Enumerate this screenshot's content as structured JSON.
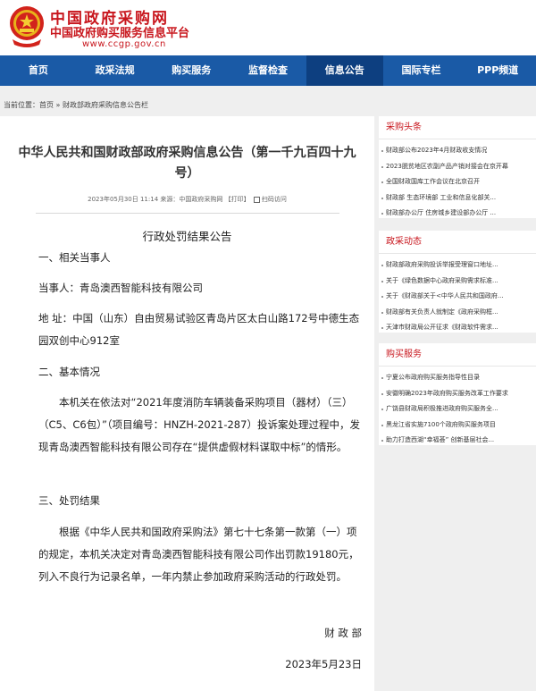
{
  "header": {
    "logo_main": "中国政府采购网",
    "logo_sub": "中国政府购买服务信息平台",
    "logo_url": "www.ccgp.gov.cn"
  },
  "nav": [
    {
      "label": "首页"
    },
    {
      "label": "政采法规"
    },
    {
      "label": "购买服务"
    },
    {
      "label": "监督检查"
    },
    {
      "label": "信息公告",
      "active": true
    },
    {
      "label": "国际专栏"
    },
    {
      "label": "PPP频道"
    }
  ],
  "breadcrumb": {
    "prefix": "当前位置：",
    "home": "首页",
    "sep": " » ",
    "current": "财政部政府采购信息公告栏"
  },
  "article": {
    "title": "中华人民共和国财政部政府采购信息公告（第一千九百四十九号）",
    "meta_date": "2023年05月30日 11:14",
    "meta_source": "来源：中国政府采购网",
    "print_label": "【打印】",
    "qr_label": "扫码访问",
    "heading": "行政处罚结果公告",
    "section1": "一、相关当事人",
    "party": "当事人：青岛澳西智能科技有限公司",
    "address": "地 址：中国（山东）自由贸易试验区青岛片区太白山路172号中德生态园双创中心912室",
    "section2": "二、基本情况",
    "basic": "本机关在依法对“2021年度消防车辆装备采购项目（器材）（三）（C5、C6包）”（项目编号：HNZH-2021-287）投诉案处理过程中，发现青岛澳西智能科技有限公司存在“提供虚假材料谋取中标”的情形。",
    "section3": "三、处罚结果",
    "result": "根据《中华人民共和国政府采购法》第七十七条第一款第（一）项的规定，本机关决定对青岛澳西智能科技有限公司作出罚款19180元，列入不良行为记录名单，一年内禁止参加政府采购活动的行政处罚。",
    "sign_org": "财 政 部",
    "sign_date": "2023年5月23日"
  },
  "sidebar": [
    {
      "title": "采购头条",
      "items": [
        "财政部公布2023年4月财政收支情况",
        "2023脱贫地区农副产品产销对接会在京开幕",
        "全国财政国库工作会议在北京召开",
        "财政部 生态环境部 工业和信息化部关...",
        "财政部办公厅 住房城乡建设部办公厅 ..."
      ]
    },
    {
      "title": "政采动态",
      "items": [
        "财政部政府采购投诉举报受理窗口地址...",
        "关于《绿色数据中心政府采购需求标准...",
        "关于《财政部关于<中华人民共和国政府...",
        "财政部有关负责人就制定《政府采购框...",
        "天津市财政局公开征求《财政软件需求..."
      ]
    },
    {
      "title": "购买服务",
      "items": [
        "宁夏公布政府购买服务指导性目录",
        "安徽明确2023年政府购买服务改革工作要求",
        "广饶县财政局积极推进政府购买服务全...",
        "黑龙江省实施7100个政府购买服务项目",
        "助力打造西湖“幸福荟” 创新基层社会..."
      ]
    }
  ],
  "colors": {
    "brand_red": "#c8161d",
    "nav_blue": "#1a5aa6",
    "nav_active": "#0d3f80"
  }
}
